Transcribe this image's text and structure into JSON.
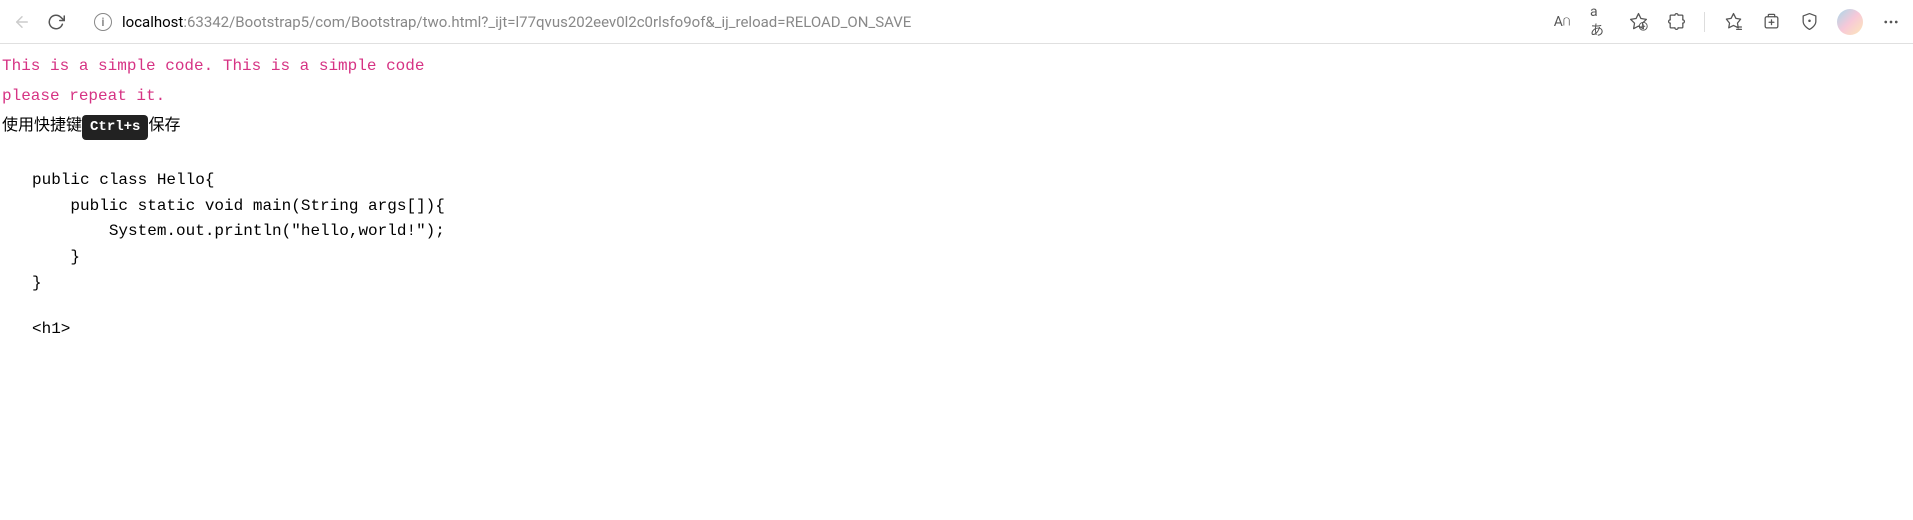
{
  "toolbar": {
    "url_host": "localhost",
    "url_path": ":63342/Bootstrap5/com/Bootstrap/two.html?_ijt=l77qvus202eev0l2c0rlsfo9of&_ij_reload=RELOAD_ON_SAVE",
    "text_size_label": "A",
    "translate_label": "aあ"
  },
  "content": {
    "pink_line1": "This is a simple code. This is a simple code",
    "pink_line2": "please repeat it.",
    "shortcut_prefix": "使用快捷键",
    "shortcut_key": "Ctrl+s",
    "shortcut_suffix": "保存",
    "code": "public class Hello{\n    public static void main(String args[]){\n        System.out.println(\"hello,world!\");\n    }\n}",
    "h1_tag": "<h1>"
  }
}
